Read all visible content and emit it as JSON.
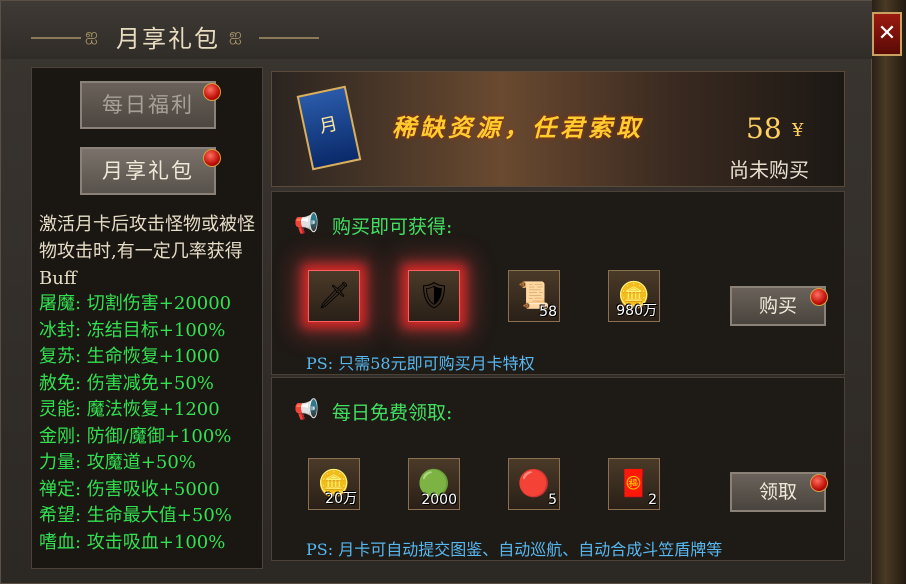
{
  "window": {
    "title": "月享礼包",
    "close_label": "✕"
  },
  "nav": [
    {
      "label": "每日福利",
      "active": false,
      "has_badge": true
    },
    {
      "label": "月享礼包",
      "active": true,
      "has_badge": true
    }
  ],
  "description": "激活月卡后攻击怪物或被怪物攻击时,有一定几率获得Buff",
  "buffs": [
    {
      "name": "屠魔",
      "effect": "切割伤害+20000"
    },
    {
      "name": "冰封",
      "effect": "冻结目标+100%"
    },
    {
      "name": "复苏",
      "effect": "生命恢复+1000"
    },
    {
      "name": "赦免",
      "effect": "伤害减免+50%"
    },
    {
      "name": "灵能",
      "effect": "魔法恢复+1200"
    },
    {
      "name": "金刚",
      "effect": "防御/魔御+100%"
    },
    {
      "name": "力量",
      "effect": "攻魔道+50%"
    },
    {
      "name": "禅定",
      "effect": "伤害吸收+5000"
    },
    {
      "name": "希望",
      "effect": "生命最大值+50%"
    },
    {
      "name": "嗜血",
      "effect": "攻击吸血+100%"
    }
  ],
  "banner": {
    "card_label": "月",
    "slogan": "稀缺资源，任君索取",
    "price": "58",
    "currency": "¥",
    "status": "尚未购买"
  },
  "purchase": {
    "title": "购买即可获得:",
    "items": [
      {
        "icon": "sword-icon",
        "glyph": "🗡",
        "count": "",
        "glow": true
      },
      {
        "icon": "armor-icon",
        "glyph": "🛡",
        "count": "",
        "glow": true
      },
      {
        "icon": "scroll-icon",
        "glyph": "📜",
        "count": "58",
        "glow": false
      },
      {
        "icon": "gold-ingot-icon",
        "glyph": "🪙",
        "count": "980万",
        "glow": false
      }
    ],
    "button_label": "购买",
    "note": "PS: 只需58元即可购买月卡特权"
  },
  "daily": {
    "title": "每日免费领取:",
    "items": [
      {
        "icon": "gold-ingot-icon",
        "glyph": "🪙",
        "count": "20万"
      },
      {
        "icon": "green-orb-icon",
        "glyph": "🟢",
        "count": "2000"
      },
      {
        "icon": "red-orb-icon",
        "glyph": "🔴",
        "count": "5"
      },
      {
        "icon": "red-envelope-icon",
        "glyph": "🧧",
        "count": "2"
      }
    ],
    "button_label": "领取",
    "note": "PS: 月卡可自动提交图鉴、自动巡航、自动合成斗笠盾牌等"
  },
  "colors": {
    "buff_name": "#32e050",
    "buff_effect": "#32e050",
    "section_title": "#42e060",
    "ps_note": "#58b8f0",
    "price": "#ffd060"
  }
}
